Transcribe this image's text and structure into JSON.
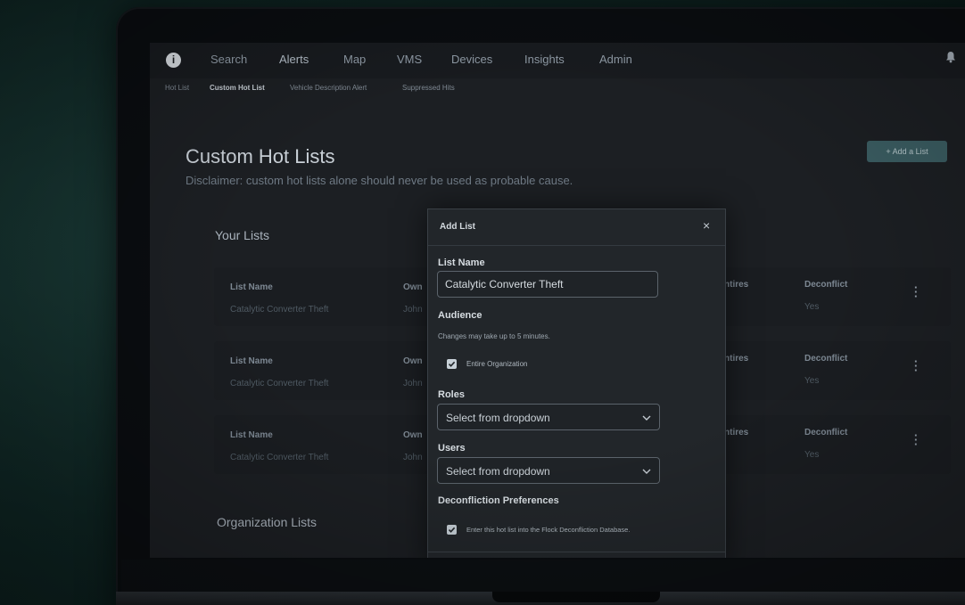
{
  "nav": {
    "items": [
      "Search",
      "Alerts",
      "Map",
      "VMS",
      "Devices",
      "Insights",
      "Admin"
    ],
    "active": "Alerts",
    "logo_icon": "info-logo-icon",
    "bell_icon": "bell-icon"
  },
  "subnav": {
    "items": [
      "Hot List",
      "Custom Hot List",
      "Vehicle Description Alert",
      "Suppressed Hits"
    ],
    "active": "Custom Hot List"
  },
  "page": {
    "title": "Custom Hot Lists",
    "disclaimer": "Disclaimer: custom hot lists alone should never be used as probable cause.",
    "add_button": "+ Add a List"
  },
  "your_lists": {
    "title": "Your Lists",
    "rows": [
      {
        "list_name_header": "List Name",
        "list_name": "Catalytic Converter Theft",
        "owner_header": "Own",
        "owner": "John",
        "entires_header": "ntires",
        "deconflict_header": "Deconflict",
        "deconflict": "Yes"
      },
      {
        "list_name_header": "List Name",
        "list_name": "Catalytic Converter Theft",
        "owner_header": "Own",
        "owner": "John",
        "entires_header": "ntires",
        "deconflict_header": "Deconflict",
        "deconflict": "Yes"
      },
      {
        "list_name_header": "List Name",
        "list_name": "Catalytic Converter Theft",
        "owner_header": "Own",
        "owner": "John",
        "entires_header": "ntires",
        "deconflict_header": "Deconflict",
        "deconflict": "Yes"
      }
    ]
  },
  "org_lists": {
    "title": "Organization Lists"
  },
  "modal": {
    "title": "Add List",
    "close": "×",
    "list_name_label": "List Name",
    "list_name_value": "Catalytic Converter Theft",
    "audience_label": "Audience",
    "audience_hint": "Changes may take up to 5 minutes.",
    "entire_org_label": "Entire Organization",
    "entire_org_checked": true,
    "roles_label": "Roles",
    "roles_placeholder": "Select from dropdown",
    "users_label": "Users",
    "users_placeholder": "Select from dropdown",
    "deconfliction_label": "Deconfliction Preferences",
    "deconfliction_check_label": "Enter this hot list into the Flock Deconfliction Database.",
    "deconfliction_checked": true
  },
  "colors": {
    "accent_button": "#3b5d62",
    "background": "#1c1f23"
  }
}
